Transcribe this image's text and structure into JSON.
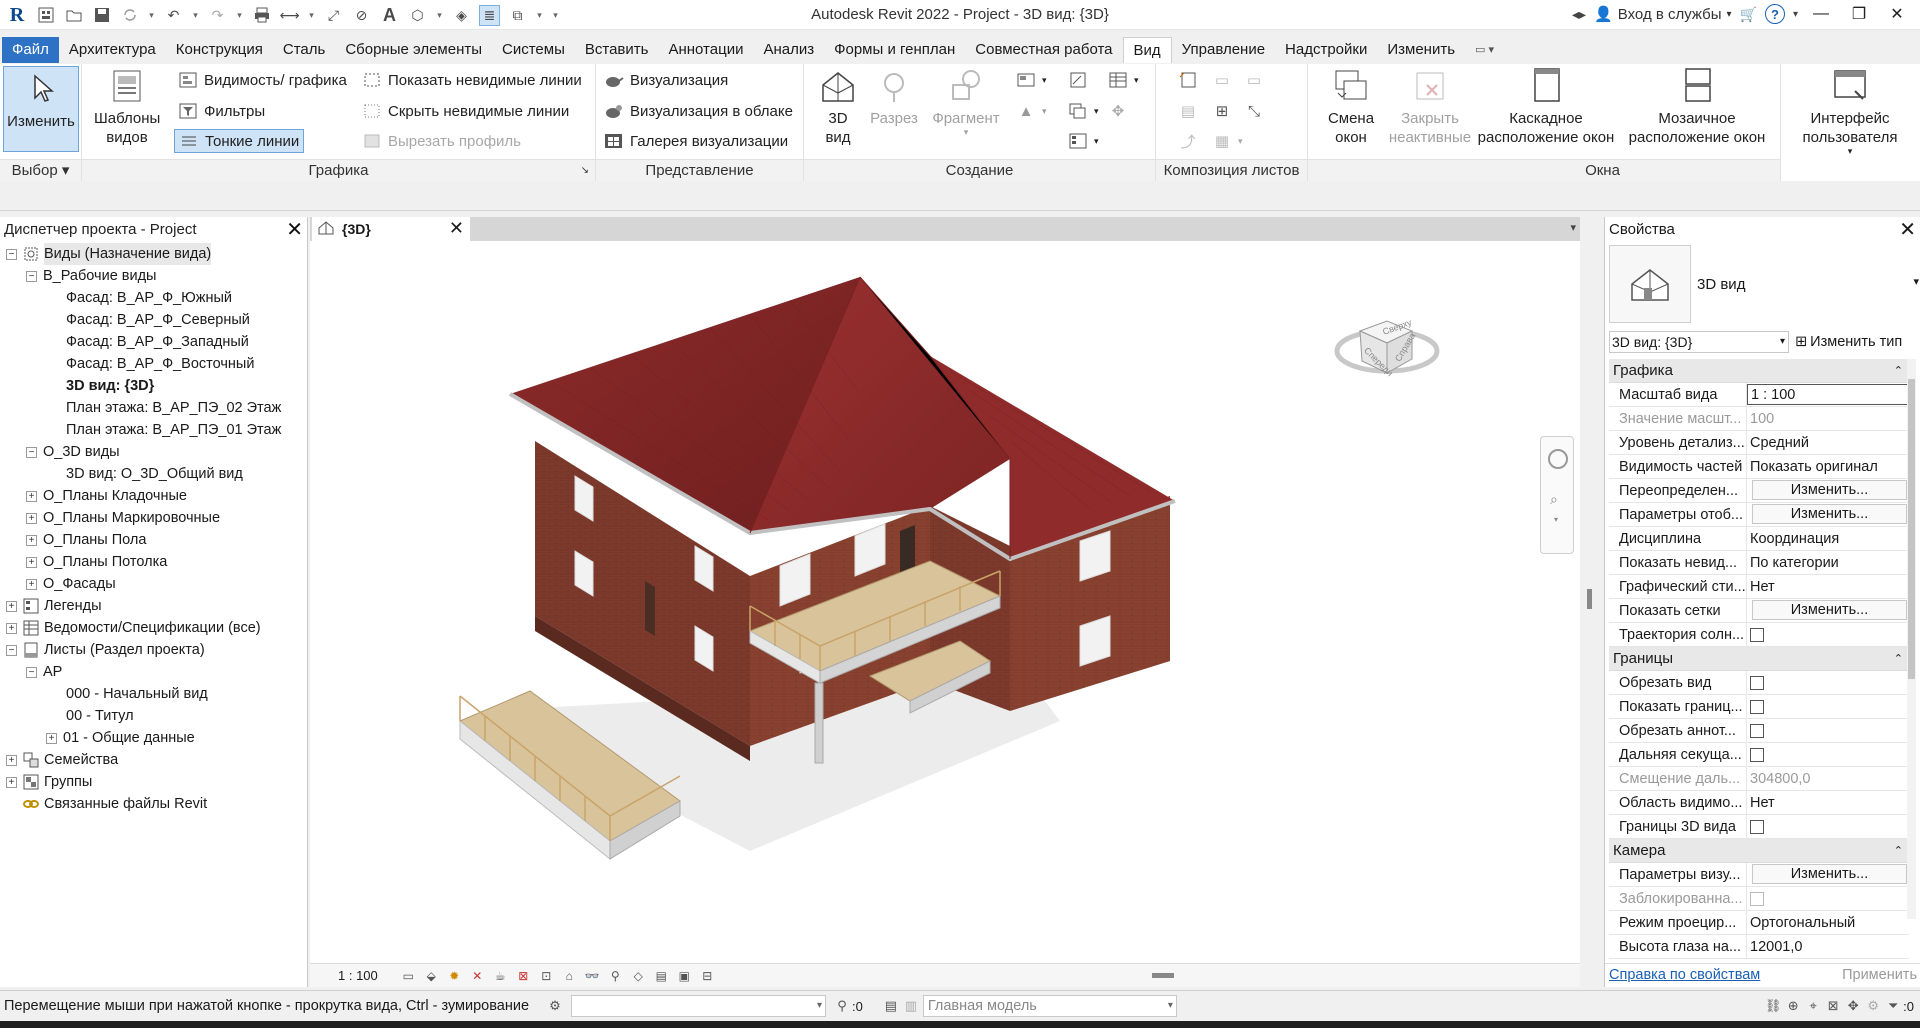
{
  "window": {
    "title": "Autodesk Revit 2022 - Project - 3D вид: {3D}",
    "sign_in": "Вход в службы"
  },
  "menu": [
    "Файл",
    "Архитектура",
    "Конструкция",
    "Сталь",
    "Сборные элементы",
    "Системы",
    "Вставить",
    "Аннотации",
    "Анализ",
    "Формы и генплан",
    "Совместная работа",
    "Вид",
    "Управление",
    "Надстройки",
    "Изменить"
  ],
  "ribbon": {
    "select": {
      "modify": "Изменить",
      "label": "Выбор"
    },
    "graphics": {
      "templates": "Шаблоны видов",
      "visibility": "Видимость/ графика",
      "filters": "Фильтры",
      "thin_lines": "Тонкие линии",
      "show_hidden": "Показать невидимые линии",
      "hide_hidden": "Скрыть невидимые линии",
      "cut_profile": "Вырезать профиль",
      "label": "Графика"
    },
    "presentation": {
      "render": "Визуализация",
      "render_cloud": "Визуализация  в облаке",
      "gallery": "Галерея  визуализации",
      "label": "Представление"
    },
    "create": {
      "view3d": "3D вид",
      "section": "Разрез",
      "callout": "Фрагмент",
      "label": "Создание"
    },
    "sheet": {
      "label": "Композиция листов"
    },
    "windows": {
      "switch": "Смена окон",
      "close_inactive": "Закрыть неактивные",
      "cascade": "Каскадное расположение окон",
      "tile": "Мозаичное расположение окон",
      "label": "Окна"
    },
    "ui": {
      "label": "Интерфейс пользователя"
    }
  },
  "browser": {
    "title": "Диспетчер проекта - Project",
    "items": [
      {
        "label": "Виды (Назначение вида)",
        "level": 0,
        "toggle": "-",
        "icon": "views",
        "sel": true
      },
      {
        "label": "В_Рабочие виды",
        "level": 1,
        "toggle": "-"
      },
      {
        "label": "Фасад: В_АР_Ф_Южный",
        "level": 2
      },
      {
        "label": "Фасад: В_АР_Ф_Северный",
        "level": 2
      },
      {
        "label": "Фасад: В_АР_Ф_Западный",
        "level": 2
      },
      {
        "label": "Фасад: В_АР_Ф_Восточный",
        "level": 2
      },
      {
        "label": "3D вид: {3D}",
        "level": 2,
        "bold": true
      },
      {
        "label": "План этажа: В_АР_ПЭ_02 Этаж",
        "level": 2
      },
      {
        "label": "План этажа: В_АР_ПЭ_01 Этаж",
        "level": 2
      },
      {
        "label": "О_3D виды",
        "level": 1,
        "toggle": "-"
      },
      {
        "label": "3D вид: О_3D_Общий вид",
        "level": 2
      },
      {
        "label": "О_Планы Кладочные",
        "level": 1,
        "toggle": "+"
      },
      {
        "label": "О_Планы Маркировочные",
        "level": 1,
        "toggle": "+"
      },
      {
        "label": "О_Планы Пола",
        "level": 1,
        "toggle": "+"
      },
      {
        "label": "О_Планы Потолка",
        "level": 1,
        "toggle": "+"
      },
      {
        "label": "О_Фасады",
        "level": 1,
        "toggle": "+"
      },
      {
        "label": "Легенды",
        "level": 0,
        "toggle": "+",
        "icon": "legend"
      },
      {
        "label": "Ведомости/Спецификации (все)",
        "level": 0,
        "toggle": "+",
        "icon": "schedule"
      },
      {
        "label": "Листы (Раздел проекта)",
        "level": 0,
        "toggle": "-",
        "icon": "sheet"
      },
      {
        "label": "АР",
        "level": 1,
        "toggle": "-"
      },
      {
        "label": "000 - Начальный вид",
        "level": 2
      },
      {
        "label": "00 - Титул",
        "level": 2
      },
      {
        "label": "01 - Общие данные",
        "level": 2,
        "toggle": "+"
      },
      {
        "label": "Семейства",
        "level": 0,
        "toggle": "+",
        "icon": "family"
      },
      {
        "label": "Группы",
        "level": 0,
        "toggle": "+",
        "icon": "group"
      },
      {
        "label": "Связанные файлы Revit",
        "level": 0,
        "icon": "link"
      }
    ]
  },
  "view": {
    "tab": "{3D}",
    "scale": "1 : 100",
    "viewcube_top": "Сверху",
    "viewcube_right": "Справа",
    "viewcube_front": "Спереди"
  },
  "properties": {
    "title": "Свойства",
    "type_name": "3D вид",
    "instance": "3D вид: {3D}",
    "edit_type": "Изменить тип",
    "groups": [
      {
        "name": "Графика",
        "rows": [
          {
            "name": "Масштаб вида",
            "value": "1 : 100",
            "kind": "box"
          },
          {
            "name": "Значение масшт...",
            "value": "100",
            "dis": true
          },
          {
            "name": "Уровень детализ...",
            "value": "Средний"
          },
          {
            "name": "Видимость частей",
            "value": "Показать оригинал"
          },
          {
            "name": "Переопределен...",
            "value": "Изменить...",
            "kind": "btn"
          },
          {
            "name": "Параметры отоб...",
            "value": "Изменить...",
            "kind": "btn"
          },
          {
            "name": "Дисциплина",
            "value": "Координация"
          },
          {
            "name": "Показать невид...",
            "value": "По категории"
          },
          {
            "name": "Графический сти...",
            "value": "Нет"
          },
          {
            "name": "Показать сетки",
            "value": "Изменить...",
            "kind": "btn"
          },
          {
            "name": "Траектория солн...",
            "value": "",
            "kind": "chk"
          }
        ]
      },
      {
        "name": "Границы",
        "rows": [
          {
            "name": "Обрезать вид",
            "value": "",
            "kind": "chk"
          },
          {
            "name": "Показать границ...",
            "value": "",
            "kind": "chk"
          },
          {
            "name": "Обрезать аннот...",
            "value": "",
            "kind": "chk"
          },
          {
            "name": "Дальняя секуща...",
            "value": "",
            "kind": "chk"
          },
          {
            "name": "Смещение даль...",
            "value": "304800,0",
            "dis": true
          },
          {
            "name": "Область видимо...",
            "value": "Нет"
          },
          {
            "name": "Границы 3D вида",
            "value": "",
            "kind": "chk"
          }
        ]
      },
      {
        "name": "Камера",
        "rows": [
          {
            "name": "Параметры визу...",
            "value": "Изменить...",
            "kind": "btn"
          },
          {
            "name": "Заблокированна...",
            "value": "",
            "kind": "chk",
            "dis": true
          },
          {
            "name": "Режим проецир...",
            "value": "Ортогональный"
          },
          {
            "name": "Высота глаза на...",
            "value": "12001,0"
          }
        ]
      }
    ],
    "help": "Справка по свойствам",
    "apply": "Применить"
  },
  "status": {
    "text": "Перемещение мыши при нажатой кнопке - прокрутка вида, Ctrl - зумирование",
    "workset_value": ":0",
    "model": "Главная модель",
    "filter_count": ":0"
  }
}
